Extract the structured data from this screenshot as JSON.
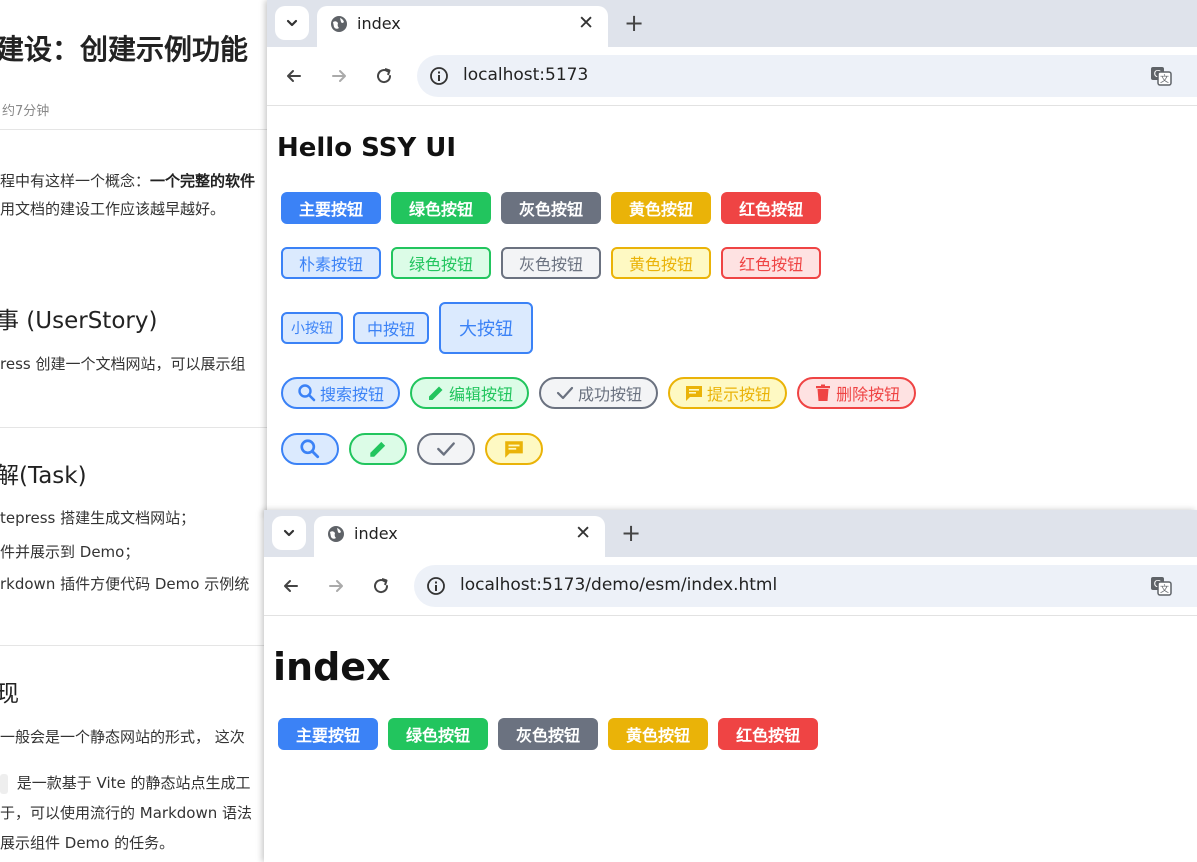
{
  "doc": {
    "title": "建设：创建示例功能",
    "meta": "约7分钟",
    "intro_line1_prefix": "程中有这样一个概念：",
    "intro_line1_bold": "一个完整的软件",
    "intro_line2": "用文档的建设工作应该越早越好。",
    "section1_title": "事 (UserStory)",
    "section1_text": "ress 创建一个文档网站，可以展示组",
    "section2_title": "解(Task)",
    "task1": "tepress 搭建生成文档网站；",
    "task2": "件并展示到 Demo；",
    "task3": "rkdown 插件方便代码 Demo 示例统",
    "section3_title": "现",
    "impl1": "一般会是一个静态网站的形式，  这次",
    "impl2": " 是一款基于 Vite 的静态站点生成工",
    "impl3": "于，可以使用流行的 Markdown 语法",
    "impl4": "展示组件 Demo 的任务。"
  },
  "window1": {
    "tab_title": "index",
    "url": "localhost:5173",
    "heading": "Hello SSY UI",
    "solid_buttons": [
      "主要按钮",
      "绿色按钮",
      "灰色按钮",
      "黄色按钮",
      "红色按钮"
    ],
    "plain_buttons": [
      "朴素按钮",
      "绿色按钮",
      "灰色按钮",
      "黄色按钮",
      "红色按钮"
    ],
    "size_buttons": {
      "small": "小按钮",
      "medium": "中按钮",
      "large": "大按钮"
    },
    "icon_buttons": [
      "搜索按钮",
      "编辑按钮",
      "成功按钮",
      "提示按钮",
      "删除按钮"
    ]
  },
  "window2": {
    "tab_title": "index",
    "url": "localhost:5173/demo/esm/index.html",
    "heading": "index",
    "solid_buttons": [
      "主要按钮",
      "绿色按钮",
      "灰色按钮",
      "黄色按钮",
      "红色按钮"
    ]
  },
  "icons": {
    "tab_dropdown": "chevron-down-icon",
    "favicon": "globe-icon",
    "close": "close-icon",
    "new_tab": "plus-icon",
    "back": "arrow-left-icon",
    "forward": "arrow-right-icon",
    "reload": "reload-icon",
    "site_info": "info-icon",
    "translate": "translate-icon",
    "search": "search-icon",
    "edit": "pencil-icon",
    "success": "check-icon",
    "message": "message-icon",
    "delete": "trash-icon"
  },
  "colors": {
    "blue": "#3b82f6",
    "green": "#22c55e",
    "gray": "#6b7280",
    "yellow": "#eab308",
    "red": "#ef4444"
  }
}
